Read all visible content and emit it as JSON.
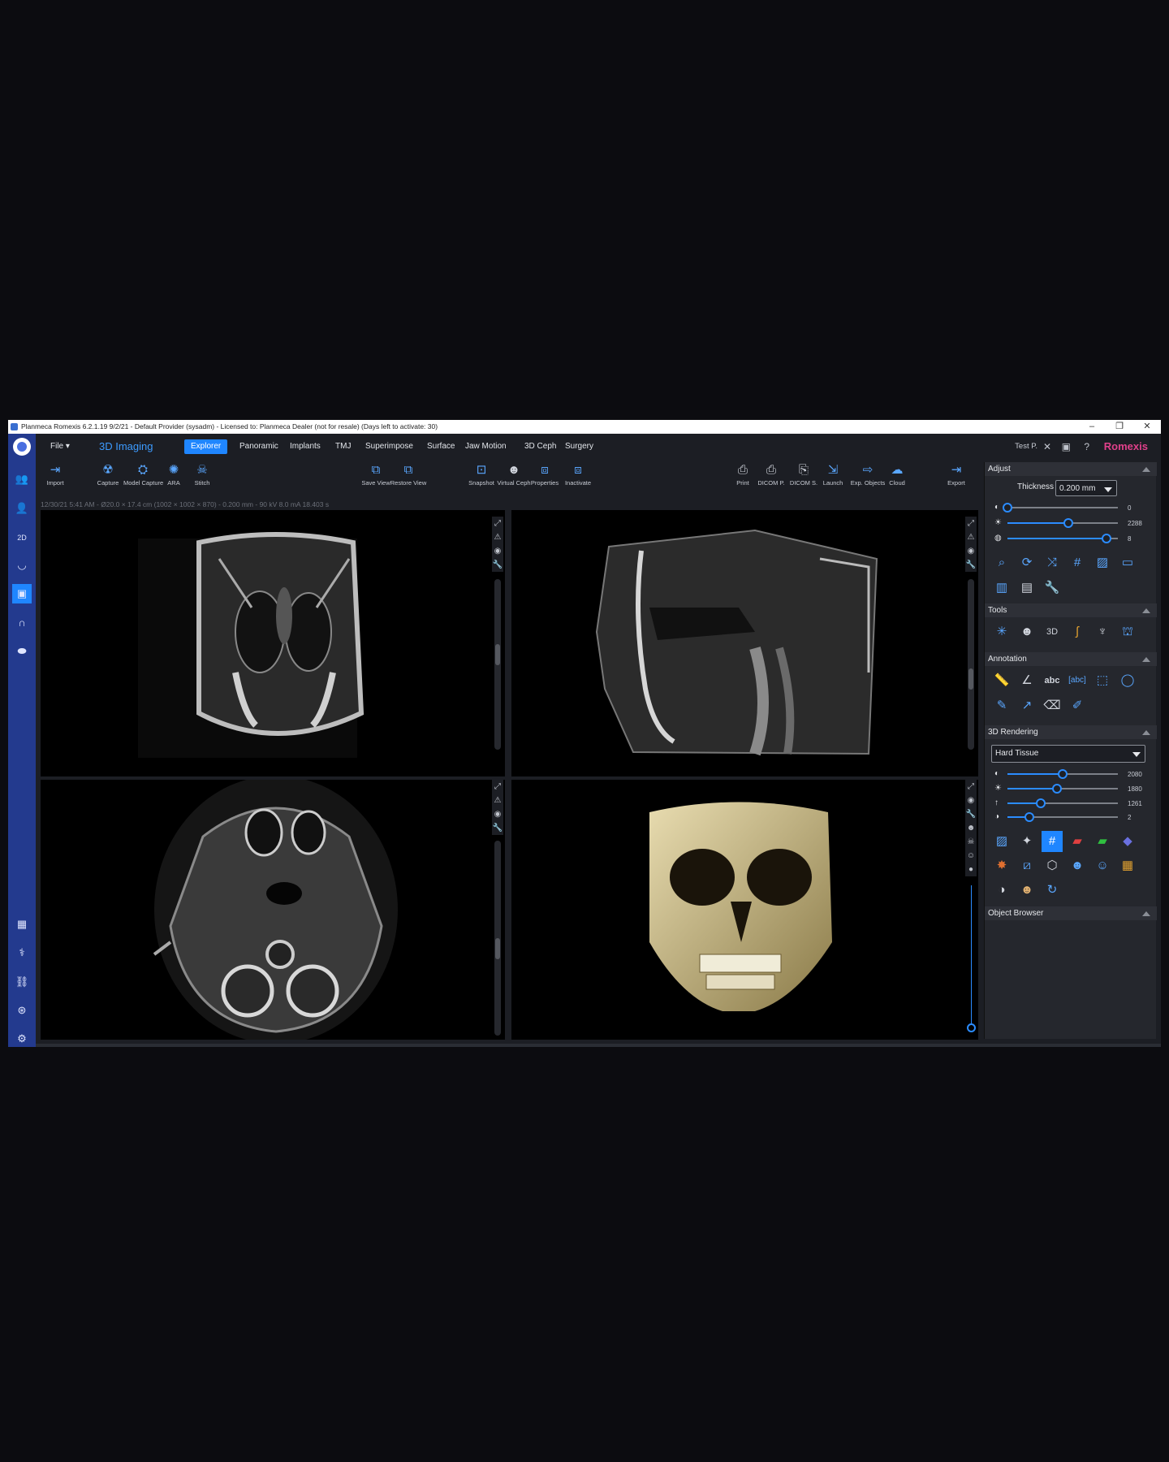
{
  "window": {
    "title": "Planmeca Romexis 6.2.1.19 9/2/21 - Default Provider (sysadm) - Licensed to: Planmeca Dealer (not for resale) (Days left to activate: 30)",
    "controls": [
      "–",
      "❐",
      "✕"
    ]
  },
  "menubar": {
    "file": "File",
    "module": "3D Imaging",
    "tabs": [
      "Explorer",
      "Panoramic",
      "Implants",
      "TMJ",
      "Superimpose",
      "Surface",
      "Jaw Motion",
      "3D Ceph",
      "Surgery"
    ],
    "active_tab": "Explorer",
    "user": "Test P.",
    "brand": "Romexis"
  },
  "toolbar": {
    "groups": [
      [
        "Import"
      ],
      [
        "Capture",
        "Model Capture",
        "ARA",
        "Stitch"
      ],
      [
        "Save View",
        "Restore View"
      ],
      [
        "Snapshot",
        "Virtual Ceph",
        "Properties",
        "Inactivate"
      ],
      [
        "Print",
        "DICOM P.",
        "DICOM S.",
        "Launch",
        "Exp. Objects",
        "Cloud"
      ],
      [
        "Export"
      ]
    ]
  },
  "info_line": "12/30/21 5:41 AM - Ø20.0 × 17.4 cm (1002 × 1002 × 870) - 0.200 mm - 90 kV 8.0 mA 18.403 s",
  "adjust": {
    "header": "Adjust",
    "thickness_label": "Thickness",
    "thickness_value": "0.200 mm",
    "sliders": [
      {
        "icon": "contrast-icon",
        "value": "0",
        "level": 0.0
      },
      {
        "icon": "brightness-icon",
        "value": "2288",
        "level": 0.55
      },
      {
        "icon": "sharpness-icon",
        "value": "8",
        "level": 0.9
      }
    ]
  },
  "tools": {
    "header": "Tools"
  },
  "annotation": {
    "header": "Annotation"
  },
  "rendering": {
    "header": "3D Rendering",
    "preset": "Hard Tissue",
    "sliders": [
      {
        "icon": "contrast-icon",
        "value": "2080",
        "level": 0.5
      },
      {
        "icon": "brightness-icon",
        "value": "1880",
        "level": 0.45
      },
      {
        "icon": "threshold-icon",
        "value": "1261",
        "level": 0.3
      },
      {
        "icon": "opacity-icon",
        "value": "2",
        "level": 0.2
      }
    ]
  },
  "object_browser": {
    "header": "Object Browser"
  },
  "colors": {
    "accent": "#1f86ff",
    "brand": "#e0408a",
    "sidebar": "#233a8e"
  }
}
